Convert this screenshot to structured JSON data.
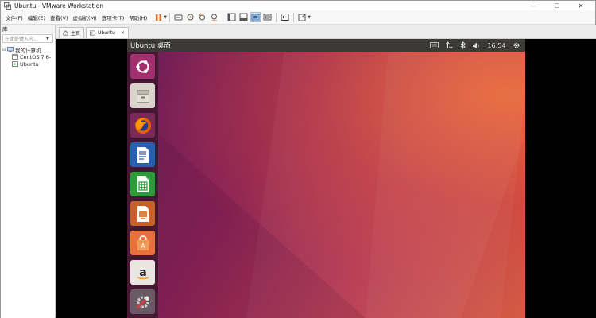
{
  "window": {
    "title": "Ubuntu - VMware Workstation",
    "controls": {
      "minimize": "—",
      "maximize": "☐",
      "close": "✕"
    }
  },
  "menubar": {
    "items": [
      "文件(F)",
      "编辑(E)",
      "查看(V)",
      "虚拟机(M)",
      "选项卡(T)",
      "帮助(H)"
    ]
  },
  "toolbar": {
    "icons": [
      "pause-icon",
      "send-ctrl-alt-del-icon",
      "snapshot-icon",
      "revert-snapshot-icon",
      "snapshot-manager-icon",
      "sidebar-toggle-icon",
      "thumbnail-bar-icon",
      "full-screen-icon",
      "unity-icon",
      "console-icon",
      "view-stretch-icon"
    ],
    "accent": "#e07020"
  },
  "sidebar": {
    "header": "库",
    "search_placeholder": "在此处键入内...",
    "tree": {
      "root": "我的计算机",
      "children": [
        "CentOS 7 6-",
        "Ubuntu"
      ]
    }
  },
  "tabs": [
    {
      "label": "主页",
      "icon": "home-icon"
    },
    {
      "label": "Ubuntu",
      "icon": "vm-icon",
      "close": "✕"
    }
  ],
  "guest": {
    "topbar_title": "Ubuntu 桌面",
    "time": "16:54",
    "indicators": [
      "keyboard-icon",
      "network-icon",
      "bluetooth-icon",
      "volume-icon",
      "settings-gear-icon"
    ],
    "launcher": [
      "ubuntu-dash-icon",
      "files-icon",
      "firefox-icon",
      "libreoffice-writer-icon",
      "libreoffice-calc-icon",
      "libreoffice-impress-icon",
      "software-center-icon",
      "amazon-icon",
      "system-settings-icon"
    ],
    "colors": {
      "topbar": "#3b3a37",
      "wallpaper_start": "#6c1d58",
      "wallpaper_end": "#d65b43"
    }
  }
}
